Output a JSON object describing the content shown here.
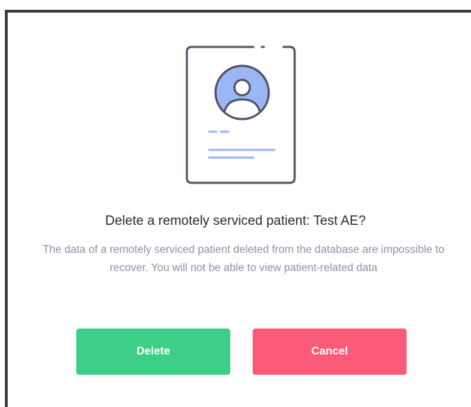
{
  "dialog": {
    "title": "Delete a remotely serviced patient: Test AE?",
    "message": "The data of a remotely serviced patient deleted from the database are impossible to recover. You will not be able to view patient-related data",
    "delete_label": "Delete",
    "cancel_label": "Cancel",
    "illustration_icon": "patient-profile-card-icon"
  },
  "colors": {
    "delete_button": "#3ecf86",
    "cancel_button": "#fb5b76",
    "message_text": "#8a92a6",
    "illustration_stroke": "#4f5566",
    "illustration_accent": "#9ab6f4"
  }
}
